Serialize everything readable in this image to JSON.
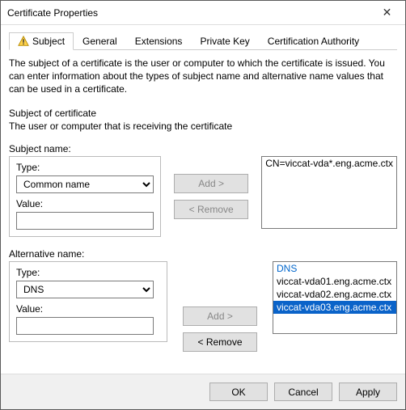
{
  "window": {
    "title": "Certificate Properties",
    "close": "✕"
  },
  "tabs": {
    "subject": "Subject",
    "general": "General",
    "extensions": "Extensions",
    "private_key": "Private Key",
    "ca": "Certification Authority"
  },
  "intro": "The subject of a certificate is the user or computer to which the certificate is issued. You can enter information about the types of subject name and alternative name values that can be used in a certificate.",
  "subject_heading": "Subject of certificate",
  "subject_sub": "The user or computer that is receiving the certificate",
  "subject_name": {
    "group_label": "Subject name:",
    "type_label": "Type:",
    "type_value": "Common name",
    "value_label": "Value:",
    "value_value": "",
    "add_label": "Add >",
    "remove_label": "< Remove",
    "list": [
      "CN=viccat-vda*.eng.acme.ctx"
    ]
  },
  "alt_name": {
    "group_label": "Alternative name:",
    "type_label": "Type:",
    "type_value": "DNS",
    "value_label": "Value:",
    "value_value": "",
    "add_label": "Add >",
    "remove_label": "< Remove",
    "header": "DNS",
    "list": [
      {
        "text": "viccat-vda01.eng.acme.ctx",
        "selected": false
      },
      {
        "text": "viccat-vda02.eng.acme.ctx",
        "selected": false
      },
      {
        "text": "viccat-vda03.eng.acme.ctx",
        "selected": true
      }
    ]
  },
  "buttons": {
    "ok": "OK",
    "cancel": "Cancel",
    "apply": "Apply"
  }
}
